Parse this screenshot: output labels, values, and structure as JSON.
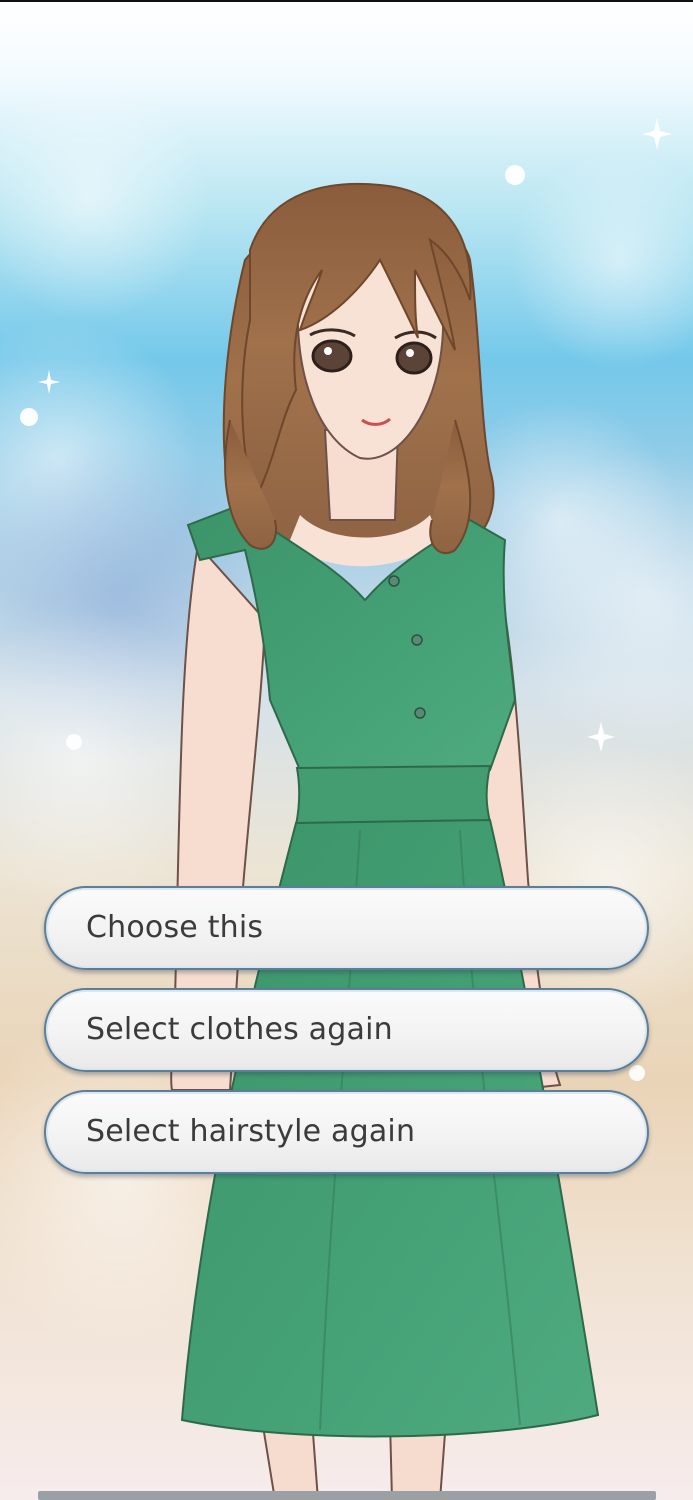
{
  "scene": {
    "background": "sky-bokeh-background",
    "character": "brown-haired-girl-in-green-dress"
  },
  "choices": [
    {
      "label": "Choose this"
    },
    {
      "label": "Select clothes again"
    },
    {
      "label": "Select hairstyle again"
    }
  ],
  "colors": {
    "button_border": "#5d7e98",
    "button_fill": "#f2f2f2",
    "button_text": "#3b3b3b",
    "dress": "#3f9a6e",
    "hair": "#9b6a45"
  }
}
